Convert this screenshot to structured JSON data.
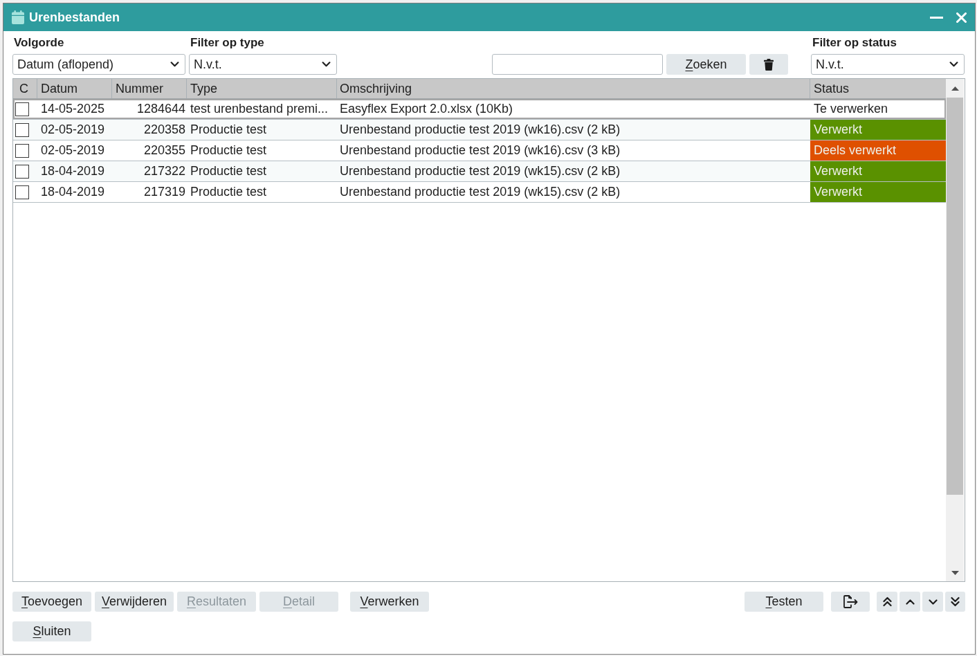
{
  "window": {
    "title": "Urenbestanden"
  },
  "filters": {
    "sort": {
      "label": "Volgorde",
      "value": "Datum (aflopend)"
    },
    "type": {
      "label": "Filter op type",
      "value": "N.v.t."
    },
    "status": {
      "label": "Filter op status",
      "value": "N.v.t."
    }
  },
  "search": {
    "button": "Zoeken"
  },
  "table": {
    "columns": [
      "C",
      "Datum",
      "Nummer",
      "Type",
      "Omschrijving",
      "Status"
    ],
    "rows": [
      {
        "checked": false,
        "selected": true,
        "date": "14-05-2025",
        "number": "1284644",
        "type": "test urenbestand premi...",
        "description": "Easyflex Export 2.0.xlsx (10Kb)",
        "status": "Te verwerken"
      },
      {
        "checked": false,
        "selected": false,
        "date": "02-05-2019",
        "number": "220358",
        "type": "Productie test",
        "description": "Urenbestand productie test 2019 (wk16).csv (2 kB)",
        "status": "Verwerkt",
        "color": "#5a9100"
      },
      {
        "checked": false,
        "selected": false,
        "date": "02-05-2019",
        "number": "220355",
        "type": "Productie test",
        "description": "Urenbestand productie test 2019 (wk16).csv (3 kB)",
        "status": "Deels verwerkt",
        "color": "#df5000"
      },
      {
        "checked": false,
        "selected": false,
        "date": "18-04-2019",
        "number": "217322",
        "type": "Productie test",
        "description": "Urenbestand productie test 2019 (wk15).csv (2 kB)",
        "status": "Verwerkt",
        "color": "#5a9100"
      },
      {
        "checked": false,
        "selected": false,
        "date": "18-04-2019",
        "number": "217319",
        "type": "Productie test",
        "description": "Urenbestand productie test 2019 (wk15).csv (2 kB)",
        "status": "Verwerkt",
        "color": "#5a9100"
      }
    ]
  },
  "bottom_bar": {
    "edit_buttons": [
      {
        "label": "Toevoegen",
        "disabled": false
      },
      {
        "label": "Verwijderen",
        "disabled": false
      },
      {
        "label": "Resultaten",
        "disabled": true
      },
      {
        "label": "Detail",
        "disabled": true
      }
    ],
    "process_buttons": [
      {
        "label": "Verwerken",
        "disabled": false
      }
    ],
    "test_buttons": [
      {
        "label": "Testen",
        "disabled": false
      }
    ],
    "close_buttons": [
      {
        "label": "Sluiten",
        "disabled": false
      }
    ]
  }
}
